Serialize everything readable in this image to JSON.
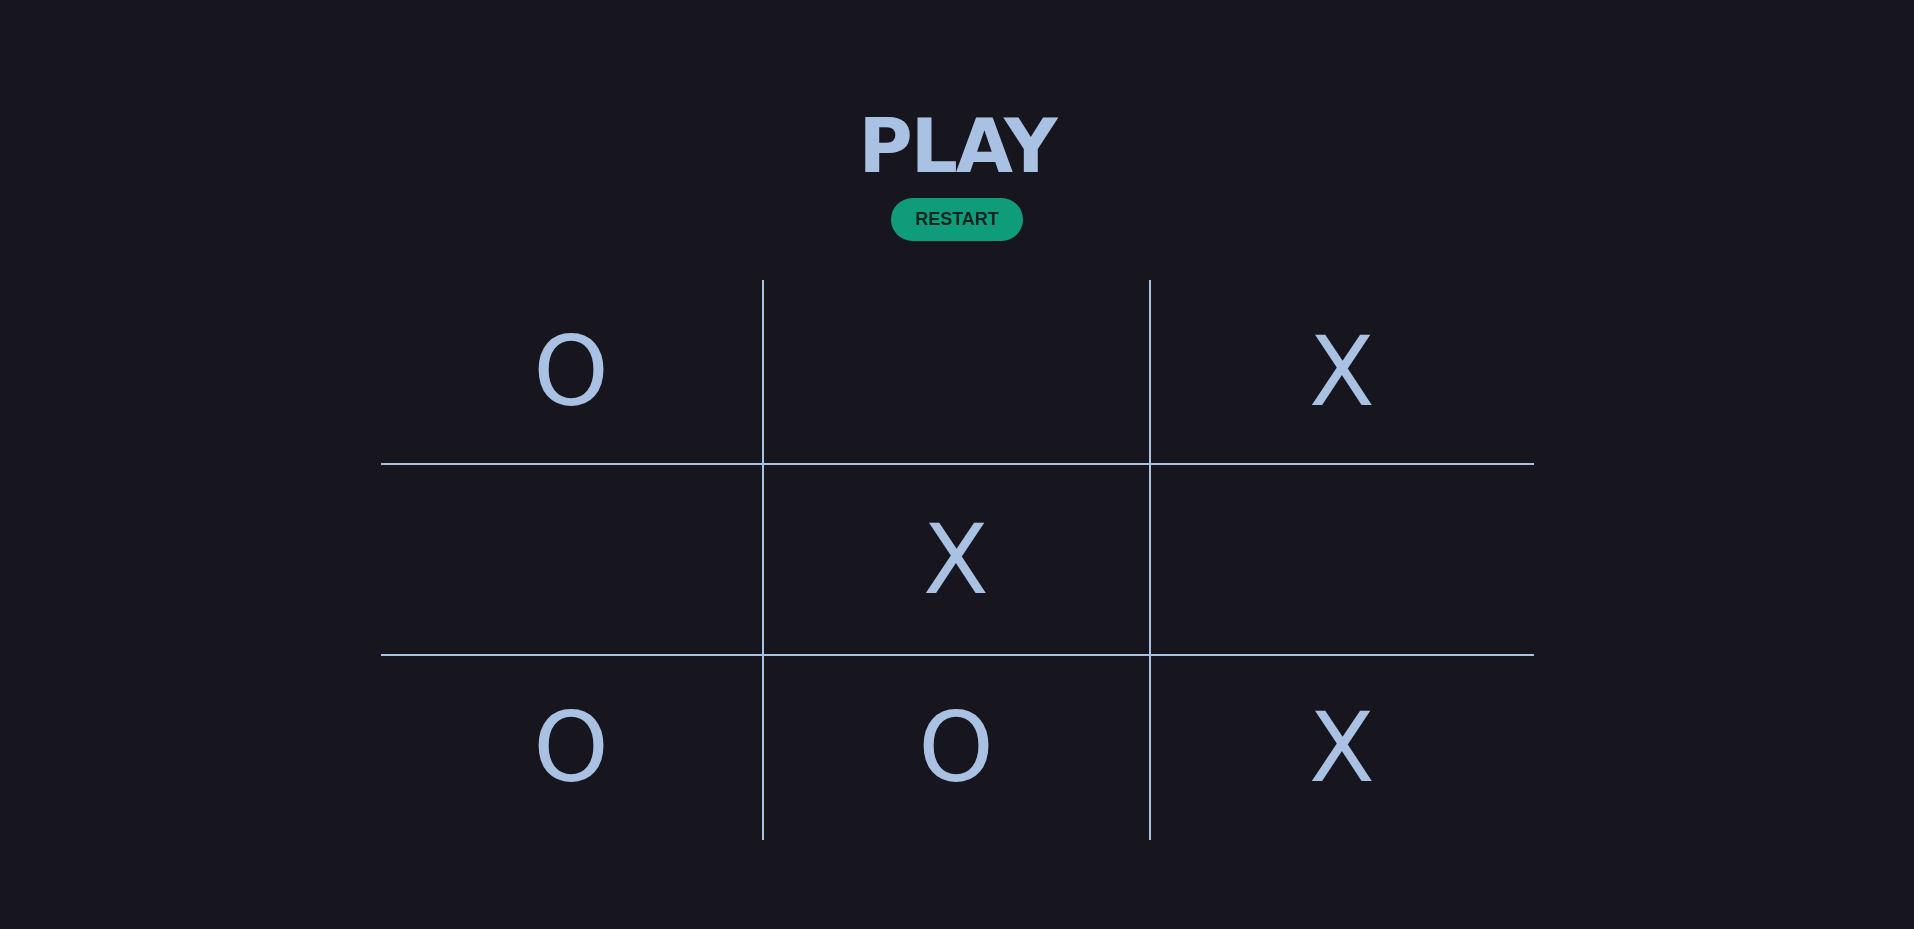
{
  "title": "PLAY",
  "restart_button": {
    "label": "RESTART"
  },
  "board": {
    "rows": [
      [
        {
          "kind": "mark",
          "text": "O"
        },
        {
          "kind": "empty"
        },
        {
          "kind": "mark",
          "text": "X"
        }
      ],
      [
        {
          "kind": "empty"
        },
        {
          "kind": "mark",
          "text": "X"
        },
        {
          "kind": "empty"
        }
      ],
      [
        {
          "kind": "mark",
          "text": "O"
        },
        {
          "kind": "mark",
          "text": "O"
        },
        {
          "kind": "mark",
          "text": "X"
        }
      ]
    ]
  }
}
